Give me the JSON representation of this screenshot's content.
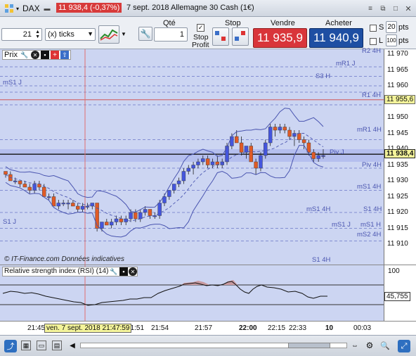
{
  "titlebar": {
    "instrument": "DAX",
    "price_badge": "11 938,4 (-0,37%)",
    "date_title": "7 sept. 2018 Allemagne 30 Cash (1€)"
  },
  "toolbar": {
    "interval_value": "21",
    "interval_unit": "(x) ticks",
    "qty_label": "Qté",
    "qty_value": "1",
    "stop_label": "Stop",
    "stop_profit_line1": "Stop",
    "stop_profit_line2": "Profit",
    "sell_label": "Vendre",
    "sell_price": "11 935,9",
    "buy_label": "Acheter",
    "buy_price": "11 940,9",
    "s_label": "S",
    "s_value": "20",
    "s_unit": "pts",
    "l_label": "L",
    "l_value": "100",
    "l_unit": "pts"
  },
  "chart": {
    "panel_label": "Prix",
    "watermark": "© IT-Finance.com  Données indicatives",
    "y_ticks": [
      "11 970",
      "11 965",
      "11 960",
      "11 950",
      "11 945",
      "11 940",
      "11 935",
      "11 930",
      "11 925",
      "11 920",
      "11 915",
      "11 910"
    ],
    "current_price_tag": "11 938,4",
    "r1_price_tag": "11 955,6",
    "levels": [
      "R2 4H",
      "mR1 J",
      "S3 H",
      "mS1 J",
      "R1 4H",
      "mR1 4H",
      "Piv J",
      "Piv 4H",
      "mS1 4H",
      "mS1 4H",
      "S1 4H",
      "S1 J",
      "mS1 J",
      "mS1 H",
      "mS2 4H",
      "S1 4H"
    ]
  },
  "rsi": {
    "panel_label": "Relative strength index (RSI) (14)",
    "top_tick": "100",
    "value_tag": "45,755"
  },
  "xaxis": {
    "labels": [
      "21:45",
      "21:51",
      "21:54",
      "21:57",
      "22:00",
      "22:15",
      "22:33",
      "10",
      "00:03"
    ],
    "cursor_label": "ven. 7 sept. 2018 21:47:59"
  },
  "colors": {
    "sell": "#d9353a",
    "buy": "#1e4fa3",
    "candle_up": "#4455dd",
    "candle_down": "#e05a25",
    "badge": "#d73a3a"
  },
  "chart_data": {
    "type": "candlestick",
    "ylim": [
      11908,
      11973
    ],
    "candles": [
      [
        11933,
        11933,
        11931,
        11932
      ],
      [
        11932,
        11933,
        11930,
        11930
      ],
      [
        11930,
        11931,
        11929,
        11930
      ],
      [
        11930,
        11930,
        11928,
        11929
      ],
      [
        11929,
        11930,
        11928,
        11928
      ],
      [
        11928,
        11929,
        11926,
        11927
      ],
      [
        11927,
        11930,
        11926,
        11929
      ],
      [
        11929,
        11930,
        11927,
        11928
      ],
      [
        11928,
        11929,
        11925,
        11925
      ],
      [
        11925,
        11926,
        11924,
        11925
      ],
      [
        11925,
        11926,
        11922,
        11922
      ],
      [
        11922,
        11924,
        11921,
        11923
      ],
      [
        11923,
        11924,
        11922,
        11923
      ],
      [
        11923,
        11924,
        11921,
        11923
      ],
      [
        11923,
        11924,
        11922,
        11922
      ],
      [
        11922,
        11923,
        11920,
        11921
      ],
      [
        11921,
        11923,
        11920,
        11922
      ],
      [
        11922,
        11923,
        11921,
        11922
      ],
      [
        11922,
        11923,
        11921,
        11923
      ],
      [
        11923,
        11923,
        11914,
        11915
      ],
      [
        11915,
        11917,
        11914,
        11917
      ],
      [
        11917,
        11918,
        11916,
        11916
      ],
      [
        11916,
        11918,
        11915,
        11917
      ],
      [
        11917,
        11919,
        11916,
        11918
      ],
      [
        11918,
        11919,
        11916,
        11917
      ],
      [
        11917,
        11919,
        11916,
        11918
      ],
      [
        11918,
        11921,
        11917,
        11920
      ],
      [
        11920,
        11921,
        11917,
        11918
      ],
      [
        11918,
        11921,
        11917,
        11920
      ],
      [
        11920,
        11922,
        11919,
        11921
      ],
      [
        11921,
        11921,
        11918,
        11919
      ],
      [
        11919,
        11920,
        11918,
        11919
      ],
      [
        11919,
        11924,
        11918,
        11923
      ],
      [
        11923,
        11926,
        11922,
        11925
      ],
      [
        11925,
        11927,
        11924,
        11927
      ],
      [
        11927,
        11929,
        11926,
        11929
      ],
      [
        11929,
        11931,
        11928,
        11930
      ],
      [
        11930,
        11934,
        11929,
        11933
      ],
      [
        11933,
        11935,
        11932,
        11934
      ],
      [
        11934,
        11936,
        11932,
        11935
      ],
      [
        11935,
        11937,
        11934,
        11936
      ],
      [
        11936,
        11938,
        11935,
        11937
      ],
      [
        11937,
        11938,
        11934,
        11935
      ],
      [
        11935,
        11937,
        11934,
        11936
      ],
      [
        11936,
        11938,
        11934,
        11935
      ],
      [
        11935,
        11937,
        11934,
        11936
      ],
      [
        11936,
        11942,
        11935,
        11941
      ],
      [
        11941,
        11945,
        11940,
        11944
      ],
      [
        11944,
        11946,
        11942,
        11942
      ],
      [
        11942,
        11944,
        11938,
        11939
      ],
      [
        11939,
        11941,
        11937,
        11941
      ],
      [
        11941,
        11942,
        11936,
        11936
      ],
      [
        11936,
        11937,
        11932,
        11934
      ],
      [
        11934,
        11939,
        11933,
        11938
      ],
      [
        11938,
        11943,
        11937,
        11942
      ],
      [
        11942,
        11948,
        11941,
        11947
      ],
      [
        11947,
        11948,
        11944,
        11946
      ],
      [
        11946,
        11948,
        11945,
        11947
      ],
      [
        11947,
        11948,
        11945,
        11946
      ],
      [
        11946,
        11947,
        11943,
        11944
      ],
      [
        11944,
        11946,
        11941,
        11945
      ],
      [
        11945,
        11946,
        11942,
        11943
      ],
      [
        11943,
        11944,
        11940,
        11942
      ],
      [
        11942,
        11943,
        11938,
        11939
      ],
      [
        11939,
        11940,
        11936,
        11937
      ],
      [
        11937,
        11939,
        11936,
        11938
      ],
      [
        11938,
        11940,
        11937,
        11938
      ]
    ]
  }
}
